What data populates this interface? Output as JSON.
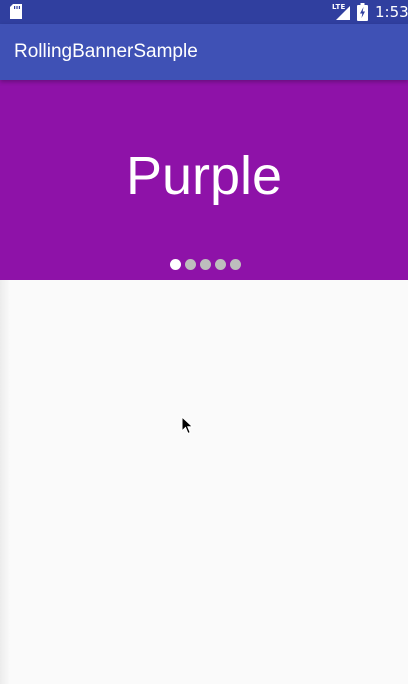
{
  "status_bar": {
    "network_label": "LTE",
    "time": "1:53",
    "icons": [
      "sd-card-icon",
      "signal-icon",
      "battery-icon"
    ]
  },
  "app_bar": {
    "title": "RollingBannerSample"
  },
  "banner": {
    "text": "Purple",
    "page_count": 5,
    "active_index": 0,
    "color": "#8e12a8"
  },
  "colors": {
    "status_bar": "#303f9f",
    "app_bar": "#3f51b5",
    "background": "#fafafa"
  }
}
